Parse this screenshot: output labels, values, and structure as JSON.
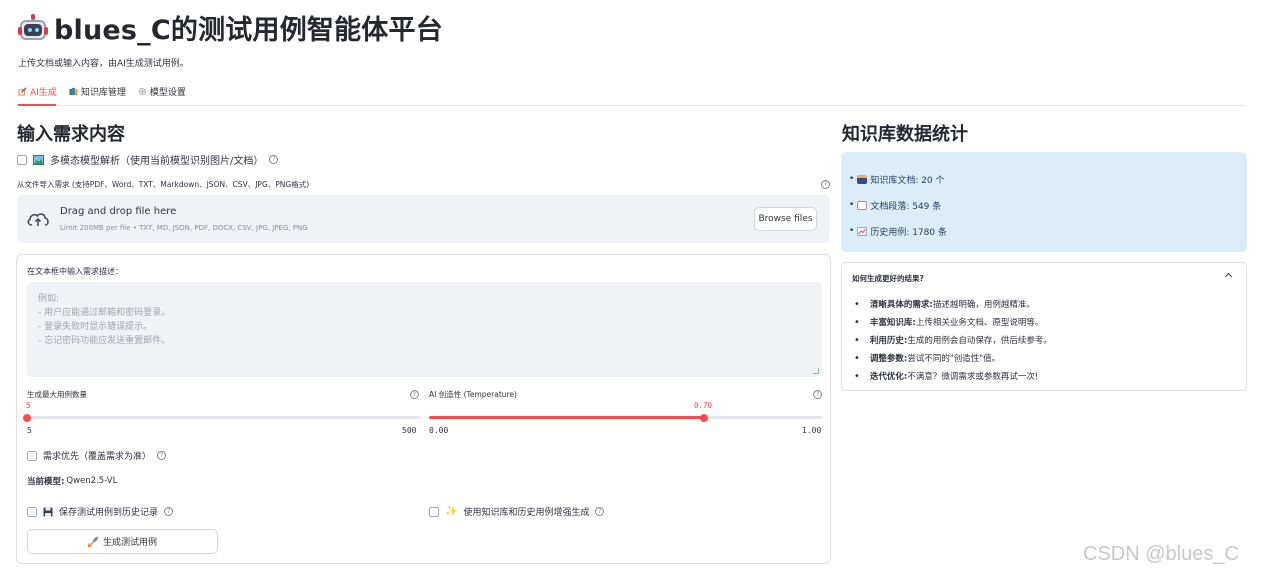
{
  "header": {
    "title": "blues_C的测试用例智能体平台",
    "subtitle": "上传文档或输入内容，由AI生成测试用例。"
  },
  "tabs": [
    {
      "label": "AI生成",
      "icon": "pencil-icon",
      "active": true
    },
    {
      "label": "知识库管理",
      "icon": "books-icon",
      "active": false
    },
    {
      "label": "模型设置",
      "icon": "gear-icon",
      "active": false
    }
  ],
  "main": {
    "heading": "输入需求内容",
    "multimodal_label": "多模态模型解析（使用当前模型识别图片/文档）",
    "import_label": "从文件导入需求 (支持PDF、Word、TXT、Markdown、JSON、CSV、JPG、PNG格式)",
    "uploader": {
      "title": "Drag and drop file here",
      "limit": "Limit 200MB per file • TXT, MD, JSON, PDF, DOCX, CSV, JPG, JPEG, PNG",
      "browse_label": "Browse files"
    },
    "textarea": {
      "label": "在文本框中输入需求描述：",
      "placeholder_lines": [
        "例如:",
        "- 用户应能通过邮箱和密码登录。",
        "- 登录失败时显示错误提示。",
        "- 忘记密码功能应发送重置邮件。"
      ]
    },
    "max_cases": {
      "label": "生成最大用例数量",
      "value": "5",
      "min": "5",
      "max": "500",
      "fraction": 0.0
    },
    "temperature": {
      "label": "AI 创造性 (Temperature)",
      "value": "0.70",
      "min": "0.00",
      "max": "1.00",
      "fraction": 0.7
    },
    "priority_label": "需求优先（覆盖需求为准）",
    "current_model_label": "当前模型:",
    "current_model_value": "Qwen2.5-VL",
    "save_history_label": "保存测试用例到历史记录",
    "enhance_label": "使用知识库和历史用例增强生成",
    "generate_label": "生成测试用例"
  },
  "sidebar": {
    "heading": "知识库数据统计",
    "stats": [
      {
        "icon": "cabinet-icon",
        "text": "知识库文档:  20 个"
      },
      {
        "icon": "page-icon",
        "text": "文档段落:  549 条"
      },
      {
        "icon": "chart-icon",
        "text": "历史用例:  1780 条"
      }
    ],
    "tips_title": "如何生成更好的结果?",
    "tips": [
      {
        "bold": "清晰具体的需求:",
        "text": " 描述越明确，用例越精准。"
      },
      {
        "bold": "丰富知识库:",
        "text": " 上传相关业务文档、原型说明等。"
      },
      {
        "bold": "利用历史:",
        "text": " 生成的用例会自动保存，供后续参考。"
      },
      {
        "bold": "调整参数:",
        "text": " 尝试不同的\"创造性\"值。"
      },
      {
        "bold": "迭代优化:",
        "text": " 不满意？微调需求或参数再试一次!"
      }
    ]
  },
  "watermark": "CSDN @blues_C",
  "colors": {
    "accent": "#ff4b4b",
    "info_bg": "#dcedfa",
    "input_bg": "#f0f2f6"
  }
}
